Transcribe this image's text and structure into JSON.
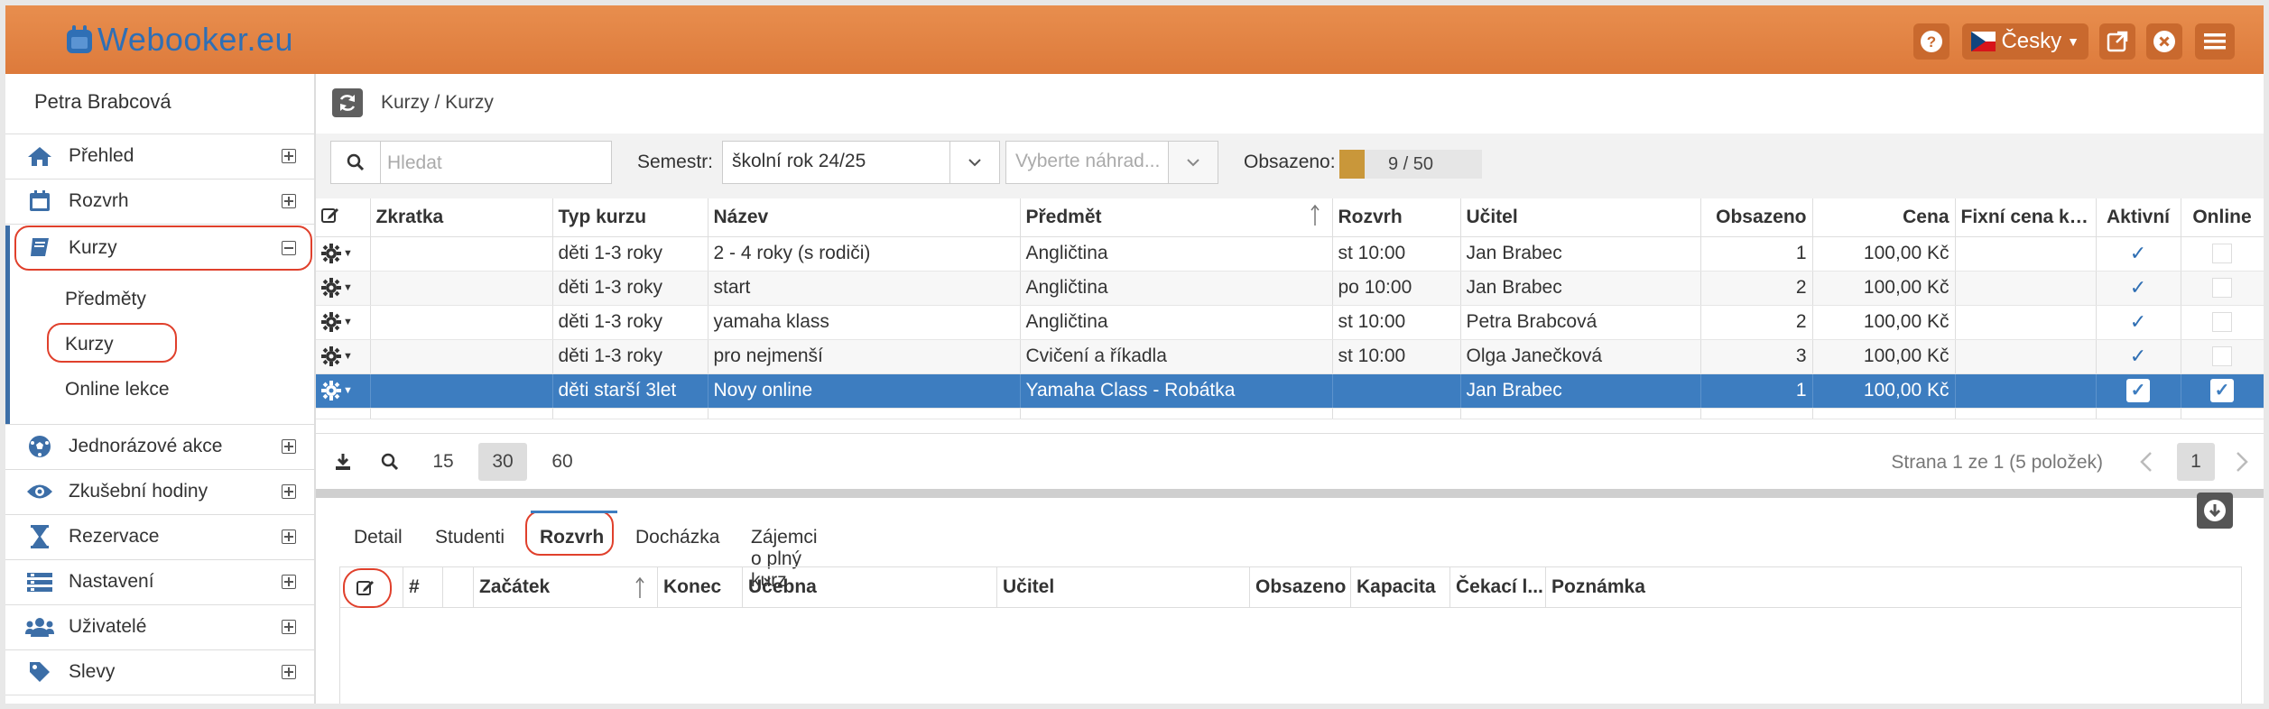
{
  "header": {
    "app_name": "Webooker.eu",
    "help_icon": "question-circle-icon",
    "language": "Česky",
    "buttons": [
      "external-link-icon",
      "close-circle-icon",
      "hamburger-menu-icon"
    ]
  },
  "sidebar": {
    "user_name": "Petra Brabcová",
    "items": [
      {
        "label": "Přehled",
        "icon": "home-icon"
      },
      {
        "label": "Rozvrh",
        "icon": "calendar-icon"
      },
      {
        "label": "Kurzy",
        "icon": "book-icon"
      },
      {
        "label": "Jednorázové akce",
        "icon": "soccer-ball-icon"
      },
      {
        "label": "Zkušební hodiny",
        "icon": "eye-icon"
      },
      {
        "label": "Rezervace",
        "icon": "hourglass-icon"
      },
      {
        "label": "Nastavení",
        "icon": "settings-list-icon"
      },
      {
        "label": "Uživatelé",
        "icon": "users-icon"
      },
      {
        "label": "Slevy",
        "icon": "tag-icon"
      }
    ],
    "subitems": [
      "Předměty",
      "Kurzy",
      "Online lekce"
    ]
  },
  "breadcrumb": "Kurzy / Kurzy",
  "filters": {
    "search_placeholder": "Hledat",
    "semestr_label": "Semestr:",
    "semestr_value": "školní rok 24/25",
    "nahrada_placeholder": "Vyberte náhrad...",
    "obsazeno_label": "Obsazeno:",
    "obsazeno_text": "9 / 50",
    "obsazeno_fraction": 0.18
  },
  "grid": {
    "columns": [
      "Zkratka",
      "Typ kurzu",
      "Název",
      "Předmět",
      "Rozvrh",
      "Učitel",
      "Obsazeno",
      "Cena",
      "Fixní cena ku...",
      "Aktivní",
      "Online"
    ],
    "rows": [
      {
        "zkratka": "",
        "typ": "děti 1-3 roky",
        "nazev": "2 - 4 roky (s rodiči)",
        "predmet": "Angličtina",
        "rozvrh": "st 10:00",
        "ucitel": "Jan Brabec",
        "obsazeno": "1",
        "cena": "100,00 Kč",
        "fixni": "",
        "aktivni": true,
        "online": false
      },
      {
        "zkratka": "",
        "typ": "děti 1-3 roky",
        "nazev": "start",
        "predmet": "Angličtina",
        "rozvrh": "po 10:00",
        "ucitel": "Jan Brabec",
        "obsazeno": "2",
        "cena": "100,00 Kč",
        "fixni": "",
        "aktivni": true,
        "online": false
      },
      {
        "zkratka": "",
        "typ": "děti 1-3 roky",
        "nazev": "yamaha klass",
        "predmet": "Angličtina",
        "rozvrh": "st 10:00",
        "ucitel": "Petra Brabcová",
        "obsazeno": "2",
        "cena": "100,00 Kč",
        "fixni": "",
        "aktivni": true,
        "online": false
      },
      {
        "zkratka": "",
        "typ": "děti 1-3 roky",
        "nazev": "pro nejmenší",
        "predmet": "Cvičení a říkadla",
        "rozvrh": "st 10:00",
        "ucitel": "Olga Janečková",
        "obsazeno": "3",
        "cena": "100,00 Kč",
        "fixni": "",
        "aktivni": true,
        "online": false
      },
      {
        "zkratka": "",
        "typ": "děti starší 3let",
        "nazev": "Novy online",
        "predmet": "Yamaha Class - Robátka",
        "rozvrh": "",
        "ucitel": "Jan Brabec",
        "obsazeno": "1",
        "cena": "100,00 Kč",
        "fixni": "",
        "aktivni": true,
        "online": true
      }
    ]
  },
  "pager": {
    "sizes": [
      "15",
      "30",
      "60"
    ],
    "active_size": "30",
    "info": "Strana 1 ze 1 (5 položek)",
    "page": "1"
  },
  "tabs": [
    "Detail",
    "Studenti",
    "Rozvrh",
    "Docházka",
    "Zájemci o plný kurz"
  ],
  "active_tab": "Rozvrh",
  "detail_columns": [
    "#",
    "Začátek",
    "Konec",
    "Učebna",
    "Učitel",
    "Obsazeno",
    "Kapacita",
    "Čekací l...",
    "Poznámka"
  ],
  "colors": {
    "header_orange": "#e2843f",
    "accent_blue": "#3d7dc0",
    "logo_blue": "#2f6fb5",
    "highlight_red": "#e0402c"
  }
}
